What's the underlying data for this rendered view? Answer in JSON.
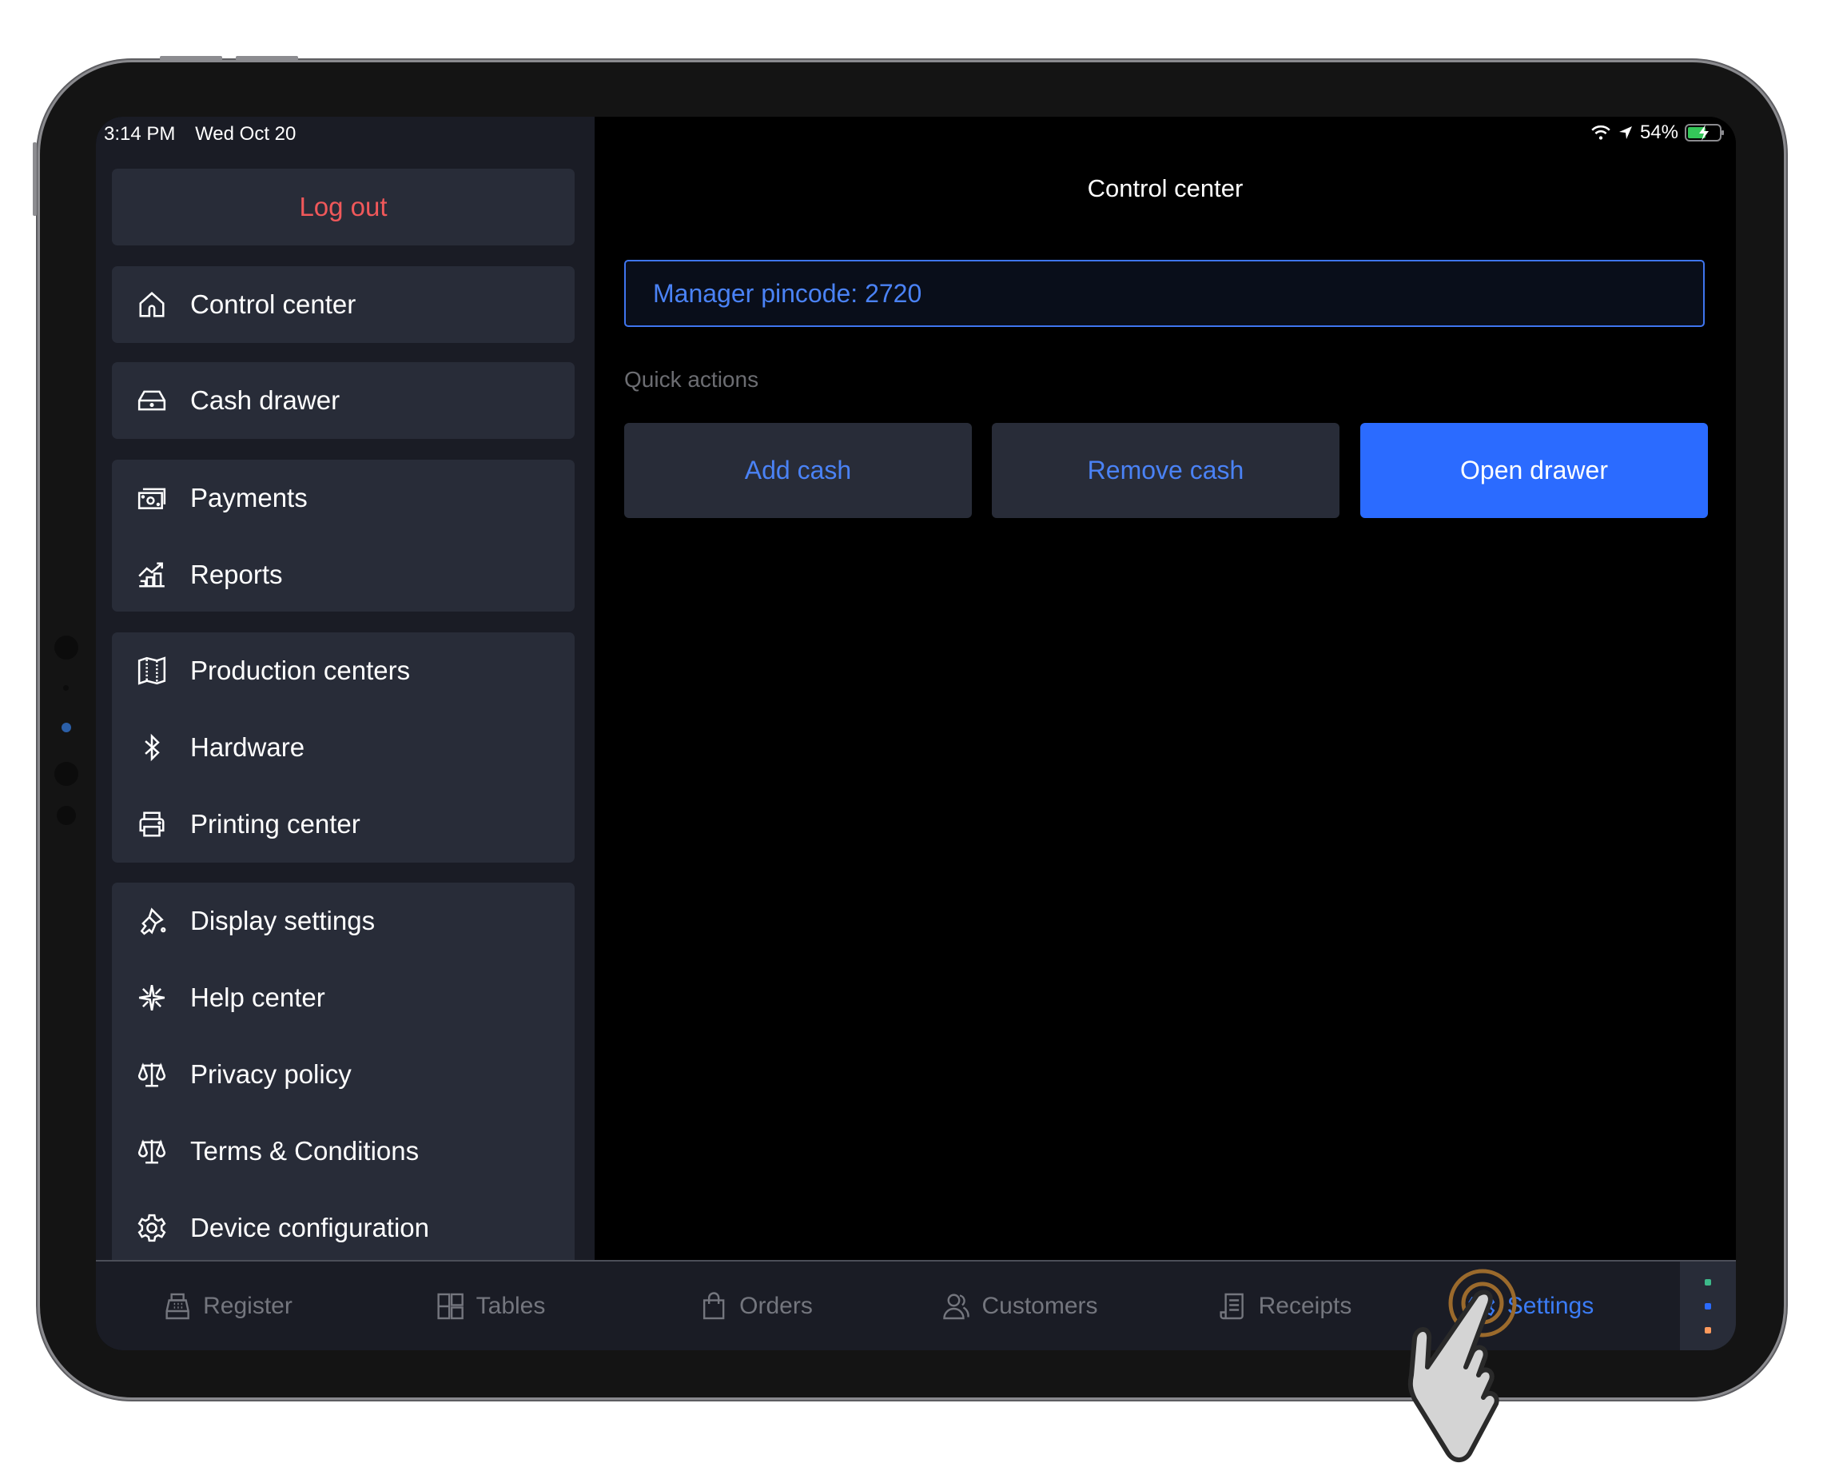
{
  "status_bar": {
    "time": "3:14 PM",
    "date": "Wed Oct 20",
    "battery_percent": "54%",
    "wifi_icon": "wifi-icon",
    "location_icon": "location-arrow-icon",
    "battery_icon": "battery-charging-icon"
  },
  "sidebar": {
    "logout_label": "Log out",
    "groups": [
      [
        {
          "label": "Control center",
          "icon": "home-icon"
        }
      ],
      [
        {
          "label": "Cash drawer",
          "icon": "cash-drawer-icon"
        }
      ],
      [
        {
          "label": "Payments",
          "icon": "banknotes-icon"
        },
        {
          "label": "Reports",
          "icon": "chart-growth-icon"
        }
      ],
      [
        {
          "label": "Production centers",
          "icon": "map-icon"
        },
        {
          "label": "Hardware",
          "icon": "bluetooth-icon"
        },
        {
          "label": "Printing center",
          "icon": "printer-icon"
        }
      ],
      [
        {
          "label": "Display settings",
          "icon": "paint-brush-icon"
        },
        {
          "label": "Help center",
          "icon": "compass-star-icon"
        },
        {
          "label": "Privacy policy",
          "icon": "scales-icon"
        },
        {
          "label": "Terms & Conditions",
          "icon": "scales-icon"
        },
        {
          "label": "Device configuration",
          "icon": "gear-icon"
        }
      ]
    ]
  },
  "main": {
    "title": "Control center",
    "pincode_text": "Manager pincode: 2720",
    "quick_actions_label": "Quick actions",
    "buttons": {
      "add_cash": "Add cash",
      "remove_cash": "Remove cash",
      "open_drawer": "Open drawer"
    }
  },
  "tabbar": {
    "tabs": [
      {
        "label": "Register",
        "icon": "cash-register-icon"
      },
      {
        "label": "Tables",
        "icon": "tables-grid-icon"
      },
      {
        "label": "Orders",
        "icon": "shopping-bag-icon"
      },
      {
        "label": "Customers",
        "icon": "users-icon"
      },
      {
        "label": "Receipts",
        "icon": "receipt-icon"
      },
      {
        "label": "Settings",
        "icon": "gear-icon",
        "active": true
      }
    ],
    "status_dots": [
      "#3dba8a",
      "#2b6bff",
      "#ff9a5c"
    ]
  },
  "colors": {
    "accent": "#2b6bff",
    "link_blue": "#4a82f5",
    "danger": "#f0585a",
    "sidebar_bg": "#1a1c25",
    "card_bg": "#282c38"
  }
}
